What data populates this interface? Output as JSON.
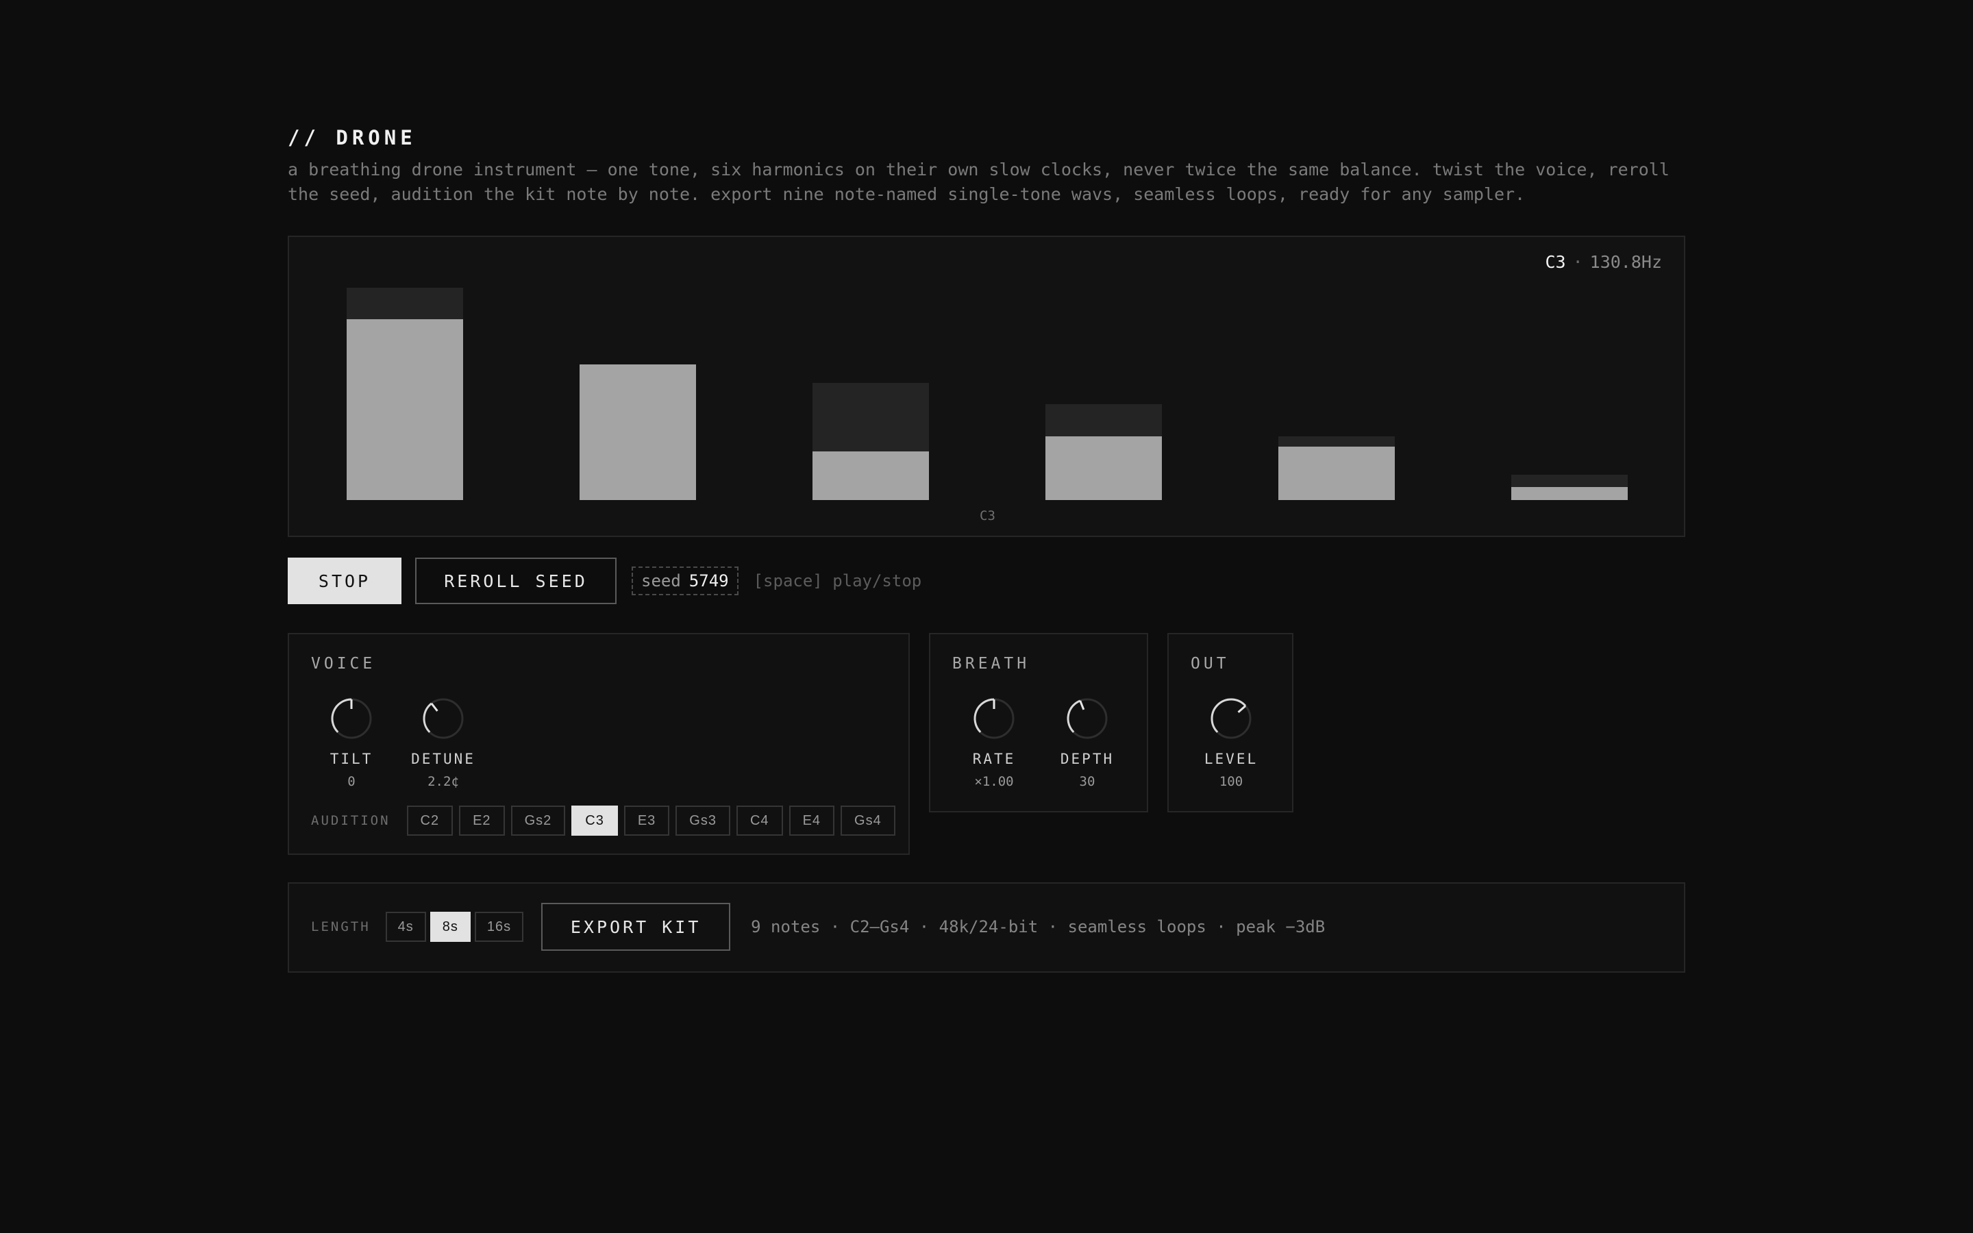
{
  "header": {
    "title": "// DRONE",
    "description": "a breathing drone instrument — one tone, six harmonics on their own slow clocks, never twice the same balance. twist the voice, reroll the seed, audition the kit note by note. export nine note-named single-tone wavs, seamless loops, ready for any sampler."
  },
  "visualizer": {
    "note": "C3",
    "separator": "·",
    "frequency": "130.8Hz",
    "bottom_label": "C3",
    "harmonics": [
      {
        "peak": 1.0,
        "level": 0.85
      },
      {
        "peak": 0.64,
        "level": 0.64
      },
      {
        "peak": 0.55,
        "level": 0.23
      },
      {
        "peak": 0.45,
        "level": 0.3
      },
      {
        "peak": 0.3,
        "level": 0.25
      },
      {
        "peak": 0.12,
        "level": 0.06
      }
    ],
    "colors": {
      "fill": "#a4a4a4",
      "ghost": "#242424"
    }
  },
  "controls": {
    "stop_label": "STOP",
    "reroll_label": "REROLL SEED",
    "seed_label": "seed",
    "seed_value": "5749",
    "hint": "[space] play/stop"
  },
  "voice": {
    "title": "VOICE",
    "knobs": [
      {
        "label": "TILT",
        "value": "0",
        "position": 0.5
      },
      {
        "label": "DETUNE",
        "value": "2.2¢",
        "position": 0.36
      }
    ],
    "audition_label": "AUDITION",
    "notes": [
      "C2",
      "E2",
      "Gs2",
      "C3",
      "E3",
      "Gs3",
      "C4",
      "E4",
      "Gs4"
    ],
    "selected_note": "C3"
  },
  "breath": {
    "title": "BREATH",
    "knobs": [
      {
        "label": "RATE",
        "value": "×1.00",
        "position": 0.5
      },
      {
        "label": "DEPTH",
        "value": "30",
        "position": 0.42
      }
    ]
  },
  "out": {
    "title": "OUT",
    "knobs": [
      {
        "label": "LEVEL",
        "value": "100",
        "position": 0.68
      }
    ]
  },
  "export": {
    "length_label": "LENGTH",
    "lengths": [
      "4s",
      "8s",
      "16s"
    ],
    "selected_length": "8s",
    "export_label": "EXPORT KIT",
    "info": "9 notes · C2–Gs4 · 48k/24-bit · seamless loops · peak −3dB"
  }
}
